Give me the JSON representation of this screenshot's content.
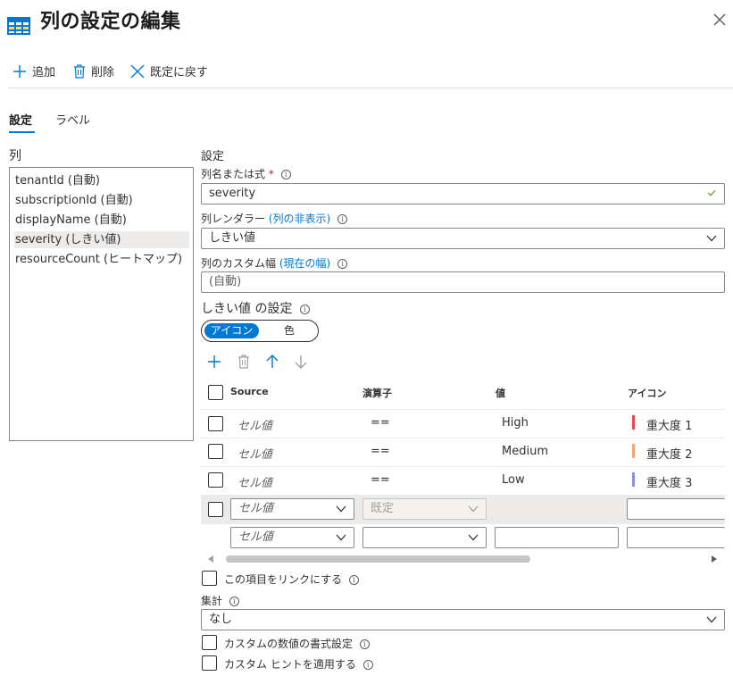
{
  "header": {
    "title": "列の設定の編集",
    "close_icon": "close-icon"
  },
  "toolbar": {
    "add_label": "追加",
    "delete_label": "削除",
    "reset_label": "既定に戻す"
  },
  "tabs": [
    {
      "label": "設定",
      "active": true
    },
    {
      "label": "ラベル",
      "active": false
    }
  ],
  "columns": {
    "header": "列",
    "items": [
      {
        "label": "tenantId (自動)",
        "selected": false
      },
      {
        "label": "subscriptionId (自動)",
        "selected": false
      },
      {
        "label": "displayName (自動)",
        "selected": false
      },
      {
        "label": "severity (しきい値)",
        "selected": true
      },
      {
        "label": "resourceCount (ヒートマップ)",
        "selected": false
      }
    ]
  },
  "settings": {
    "header": "設定",
    "column_name_label": "列名または式",
    "required_mark": "*",
    "column_name_value": "severity",
    "renderer_label": "列レンダラー",
    "renderer_link": "(列の非表示)",
    "renderer_value": "しきい値",
    "width_label": "列のカスタム幅",
    "width_link": "(現在の幅)",
    "width_placeholder": "(自動)",
    "threshold_header": "しきい値 の設定",
    "toggle": {
      "on_label": "アイコン",
      "off_label": "色"
    }
  },
  "threshold_table": {
    "headers": {
      "source": "Source",
      "operator": "演算子",
      "value": "値",
      "icon": "アイコン"
    },
    "rows": [
      {
        "source": "セル値",
        "operator": "==",
        "value": "High",
        "icon_label": "重大度 1",
        "color": "#e8474c"
      },
      {
        "source": "セル値",
        "operator": "==",
        "value": "Medium",
        "icon_label": "重大度 2",
        "color": "#f2a37a"
      },
      {
        "source": "セル値",
        "operator": "==",
        "value": "Low",
        "icon_label": "重大度 3",
        "color": "#8a8fe0"
      }
    ],
    "default_row": {
      "source": "セル値",
      "operator": "既定"
    },
    "new_row": {
      "source": "セル値"
    }
  },
  "options": {
    "link_label": "この項目をリンクにする",
    "aggregate_label": "集計",
    "aggregate_value": "なし",
    "number_format_label": "カスタムの数値の書式設定",
    "hint_label": "カスタム ヒントを適用する"
  },
  "colors": {
    "accent": "#0078d4",
    "check": "#57a300"
  }
}
